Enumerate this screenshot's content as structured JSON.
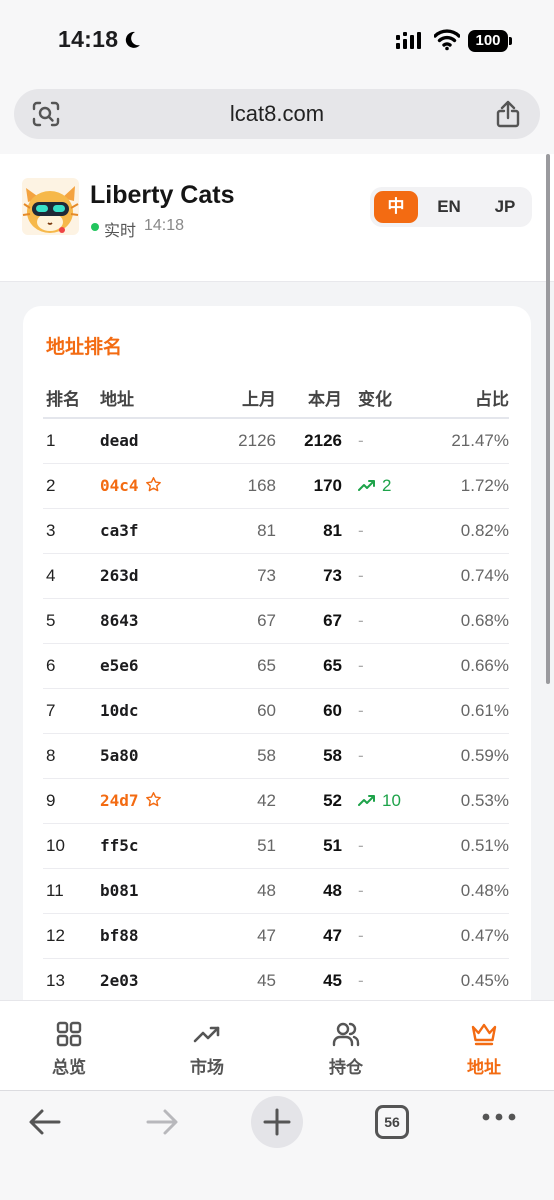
{
  "status_bar": {
    "time": "14:18",
    "battery": "100"
  },
  "browser": {
    "url": "lcat8.com",
    "tab_count": "56"
  },
  "header": {
    "title": "Liberty Cats",
    "live_label": "实时",
    "live_time": "14:18",
    "languages": [
      "中",
      "EN",
      "JP"
    ],
    "active_language": "中"
  },
  "ranking": {
    "title": "地址排名",
    "columns": [
      "排名",
      "地址",
      "上月",
      "本月",
      "变化",
      "占比"
    ],
    "rows": [
      {
        "rank": "1",
        "address": "dead",
        "last": "2126",
        "current": "2126",
        "change": "-",
        "share": "21.47%",
        "starred": false
      },
      {
        "rank": "2",
        "address": "04c4",
        "last": "168",
        "current": "170",
        "change": "2",
        "share": "1.72%",
        "starred": true
      },
      {
        "rank": "3",
        "address": "ca3f",
        "last": "81",
        "current": "81",
        "change": "-",
        "share": "0.82%",
        "starred": false
      },
      {
        "rank": "4",
        "address": "263d",
        "last": "73",
        "current": "73",
        "change": "-",
        "share": "0.74%",
        "starred": false
      },
      {
        "rank": "5",
        "address": "8643",
        "last": "67",
        "current": "67",
        "change": "-",
        "share": "0.68%",
        "starred": false
      },
      {
        "rank": "6",
        "address": "e5e6",
        "last": "65",
        "current": "65",
        "change": "-",
        "share": "0.66%",
        "starred": false
      },
      {
        "rank": "7",
        "address": "10dc",
        "last": "60",
        "current": "60",
        "change": "-",
        "share": "0.61%",
        "starred": false
      },
      {
        "rank": "8",
        "address": "5a80",
        "last": "58",
        "current": "58",
        "change": "-",
        "share": "0.59%",
        "starred": false
      },
      {
        "rank": "9",
        "address": "24d7",
        "last": "42",
        "current": "52",
        "change": "10",
        "share": "0.53%",
        "starred": true
      },
      {
        "rank": "10",
        "address": "ff5c",
        "last": "51",
        "current": "51",
        "change": "-",
        "share": "0.51%",
        "starred": false
      },
      {
        "rank": "11",
        "address": "b081",
        "last": "48",
        "current": "48",
        "change": "-",
        "share": "0.48%",
        "starred": false
      },
      {
        "rank": "12",
        "address": "bf88",
        "last": "47",
        "current": "47",
        "change": "-",
        "share": "0.47%",
        "starred": false
      },
      {
        "rank": "13",
        "address": "2e03",
        "last": "45",
        "current": "45",
        "change": "-",
        "share": "0.45%",
        "starred": false
      }
    ]
  },
  "tabbar": {
    "items": [
      {
        "label": "总览",
        "icon": "grid-icon"
      },
      {
        "label": "市场",
        "icon": "trend-icon"
      },
      {
        "label": "持仓",
        "icon": "users-icon"
      },
      {
        "label": "地址",
        "icon": "crown-icon"
      }
    ],
    "active": "地址"
  },
  "colors": {
    "accent": "#f36b12",
    "up": "#1ea34a",
    "live": "#22c55e"
  }
}
